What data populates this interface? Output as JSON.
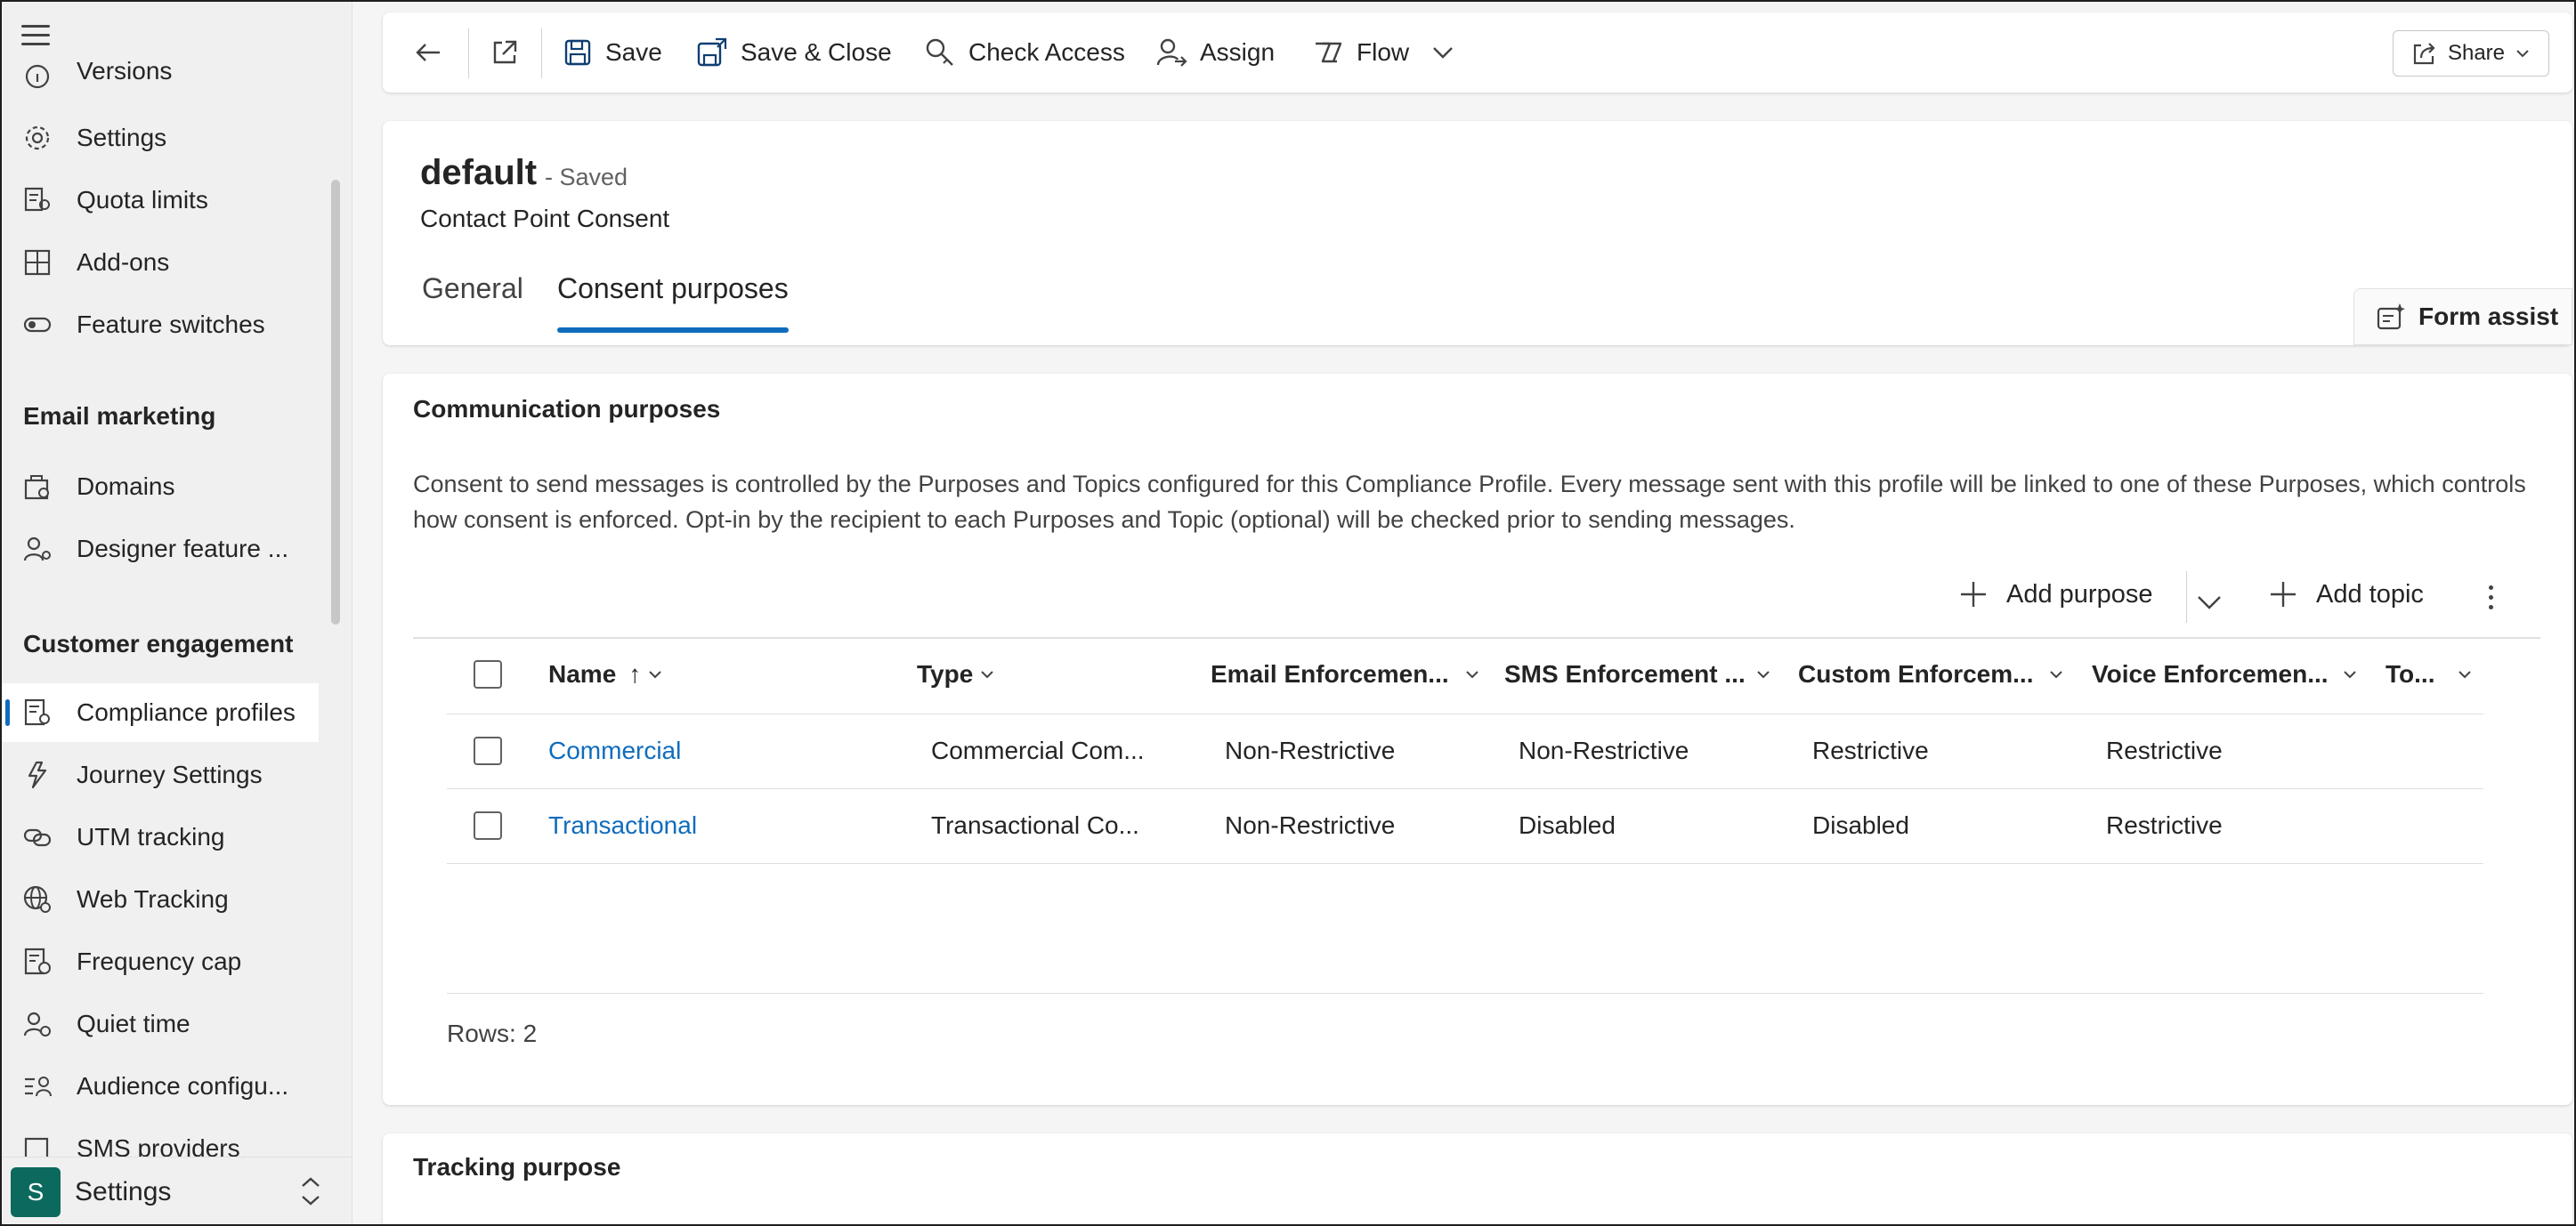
{
  "sidebar": {
    "items_top": [
      {
        "label": "Versions",
        "icon": "info-icon"
      },
      {
        "label": "Settings",
        "icon": "gear-icon"
      },
      {
        "label": "Quota limits",
        "icon": "quota-icon"
      },
      {
        "label": "Add-ons",
        "icon": "addons-icon"
      },
      {
        "label": "Feature switches",
        "icon": "toggle-icon"
      }
    ],
    "group_email": "Email marketing",
    "items_email": [
      {
        "label": "Domains",
        "icon": "domains-icon"
      },
      {
        "label": "Designer feature ...",
        "icon": "designer-icon"
      }
    ],
    "group_customer": "Customer engagement",
    "items_customer": [
      {
        "label": "Compliance profiles",
        "icon": "compliance-icon"
      },
      {
        "label": "Journey Settings",
        "icon": "journey-icon"
      },
      {
        "label": "UTM tracking",
        "icon": "link-icon"
      },
      {
        "label": "Web Tracking",
        "icon": "globe-icon"
      },
      {
        "label": "Frequency cap",
        "icon": "frequency-icon"
      },
      {
        "label": "Quiet time",
        "icon": "quiet-time-icon"
      },
      {
        "label": "Audience configu...",
        "icon": "audience-icon"
      },
      {
        "label": "SMS providers",
        "icon": "sms-icon"
      }
    ],
    "area": {
      "avatar": "S",
      "name": "Settings"
    }
  },
  "toolbar": {
    "save": "Save",
    "save_close": "Save & Close",
    "check_access": "Check Access",
    "assign": "Assign",
    "flow": "Flow",
    "share": "Share"
  },
  "record": {
    "title": "default",
    "status": "- Saved",
    "entity": "Contact Point Consent",
    "tabs": [
      "General",
      "Consent purposes"
    ],
    "form_assist": "Form assist"
  },
  "section": {
    "title": "Communication purposes",
    "description": "Consent to send messages is controlled by the Purposes and Topics configured for this Compliance Profile. Every message sent with this profile will be linked to one of these Purposes, which controls how consent is enforced. Opt-in by the recipient to each Purposes and Topic (optional) will be checked prior to sending messages.",
    "add_purpose": "Add purpose",
    "add_topic": "Add topic",
    "columns": [
      "Name",
      "Type",
      "Email Enforcemen...",
      "SMS Enforcement ...",
      "Custom Enforcem...",
      "Voice Enforcemen...",
      "To..."
    ],
    "sort_indicator": "↑",
    "rows": [
      [
        "Commercial",
        "Commercial Com...",
        "Non-Restrictive",
        "Non-Restrictive",
        "Restrictive",
        "Restrictive"
      ],
      [
        "Transactional",
        "Transactional Co...",
        "Non-Restrictive",
        "Disabled",
        "Disabled",
        "Restrictive"
      ]
    ],
    "row_count": "Rows: 2"
  },
  "tracking": {
    "title": "Tracking purpose"
  },
  "colors": {
    "accent": "#0f6cbd",
    "avatar": "#0b6a5d"
  }
}
